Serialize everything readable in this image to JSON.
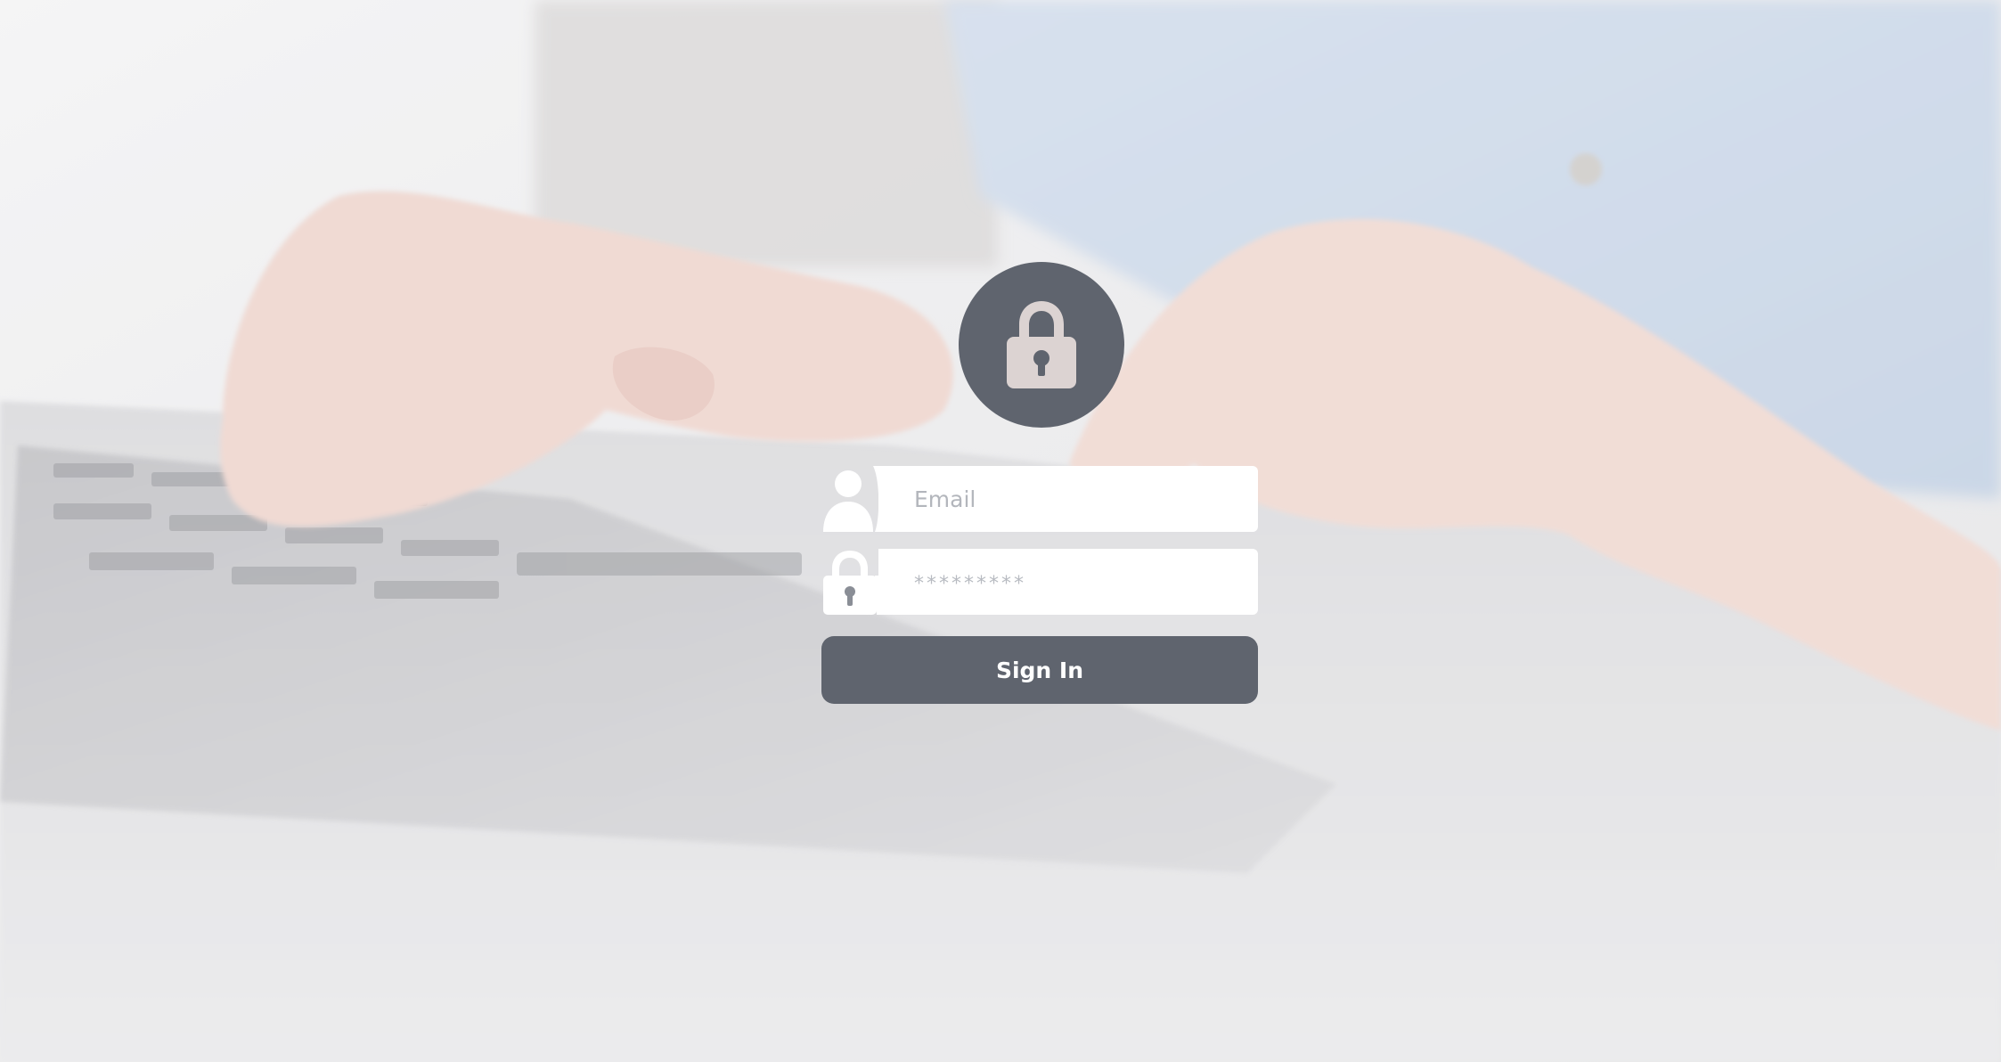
{
  "form": {
    "email_placeholder": "Email",
    "password_placeholder": "*********",
    "signin_label": "Sign In"
  },
  "icons": {
    "header": "lock-icon",
    "email": "user-icon",
    "password": "padlock-icon"
  },
  "colors": {
    "accent": "#5f646e",
    "input_background": "#ffffff",
    "button_text": "#ffffff",
    "lock_glyph": "#dcd3d2"
  }
}
